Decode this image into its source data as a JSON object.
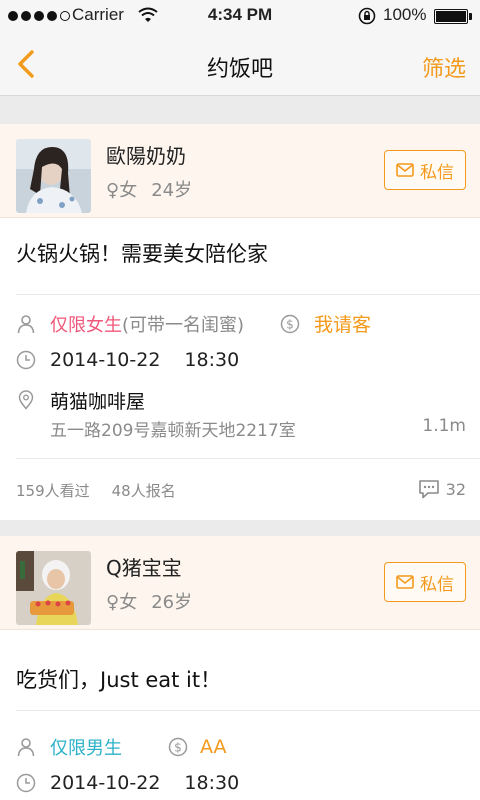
{
  "status_bar": {
    "carrier": "Carrier",
    "time": "4:34 PM",
    "battery": "100%"
  },
  "nav": {
    "title": "约饭吧",
    "filter_label": "筛选"
  },
  "posts": [
    {
      "username": "歐陽奶奶",
      "gender_symbol": "♀",
      "gender": "女",
      "age": "24岁",
      "message_label": "私信",
      "content": "火锅火锅！需要美女陪伦家",
      "restriction": "仅限女生",
      "companion_note": "(可带一名闺蜜)",
      "payer": "我请客",
      "date": "2014-10-22",
      "time": "18:30",
      "place_name": "萌猫咖啡屋",
      "place_address": "五一路209号嘉顿新天地2217室",
      "distance": "1.1m",
      "views": "159人看过",
      "signups": "48人报名",
      "comment_count": "32"
    },
    {
      "username": "Q猪宝宝",
      "gender_symbol": "♀",
      "gender": "女",
      "age": "26岁",
      "message_label": "私信",
      "content": "吃货们，Just eat it！",
      "restriction": "仅限男生",
      "payer": "AA",
      "date": "2014-10-22",
      "time": "18:30"
    }
  ],
  "colors": {
    "accent": "#f39a1c",
    "female": "#f0587b",
    "male": "#2db2c9"
  }
}
